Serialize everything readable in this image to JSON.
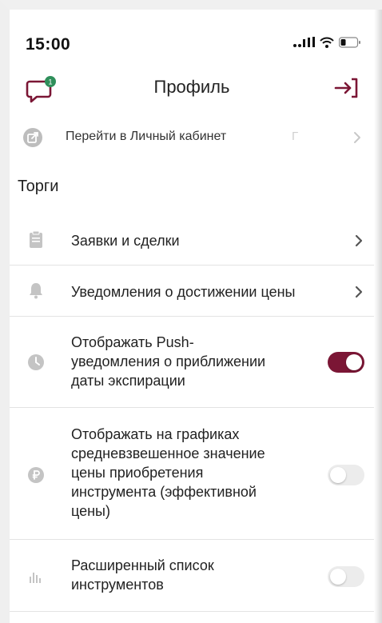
{
  "status_bar": {
    "time": "15:00"
  },
  "header": {
    "title": "Профиль",
    "badge_count": "1"
  },
  "cabinet": {
    "label": "Перейти в Личный кабинет",
    "trail": "Г"
  },
  "section": {
    "title": "Торги"
  },
  "rows": [
    {
      "label": "Заявки и сделки"
    },
    {
      "label": "Уведомления о достижении цены"
    },
    {
      "label_lines": [
        "Отображать Push-",
        "уведомления о приближении",
        "даты экспирации"
      ],
      "toggle": true
    },
    {
      "label_lines": [
        "Отображать на графиках",
        "средневзвешенное значение",
        "цены приобретения",
        "инструмента (эффективной",
        "цены)"
      ],
      "toggle": false
    },
    {
      "label_lines": [
        "Расширенный список",
        "инструментов"
      ],
      "toggle": false
    }
  ],
  "colors": {
    "accent": "#7b1635",
    "badge": "#2f8f5b",
    "icon_gray": "#c4c4c4"
  },
  "icons": [
    "chat-icon",
    "logout-icon",
    "external-link-icon",
    "clipboard-icon",
    "bell-icon",
    "clock-icon",
    "ruble-icon",
    "bar-chart-icon",
    "chevron-right-icon"
  ]
}
